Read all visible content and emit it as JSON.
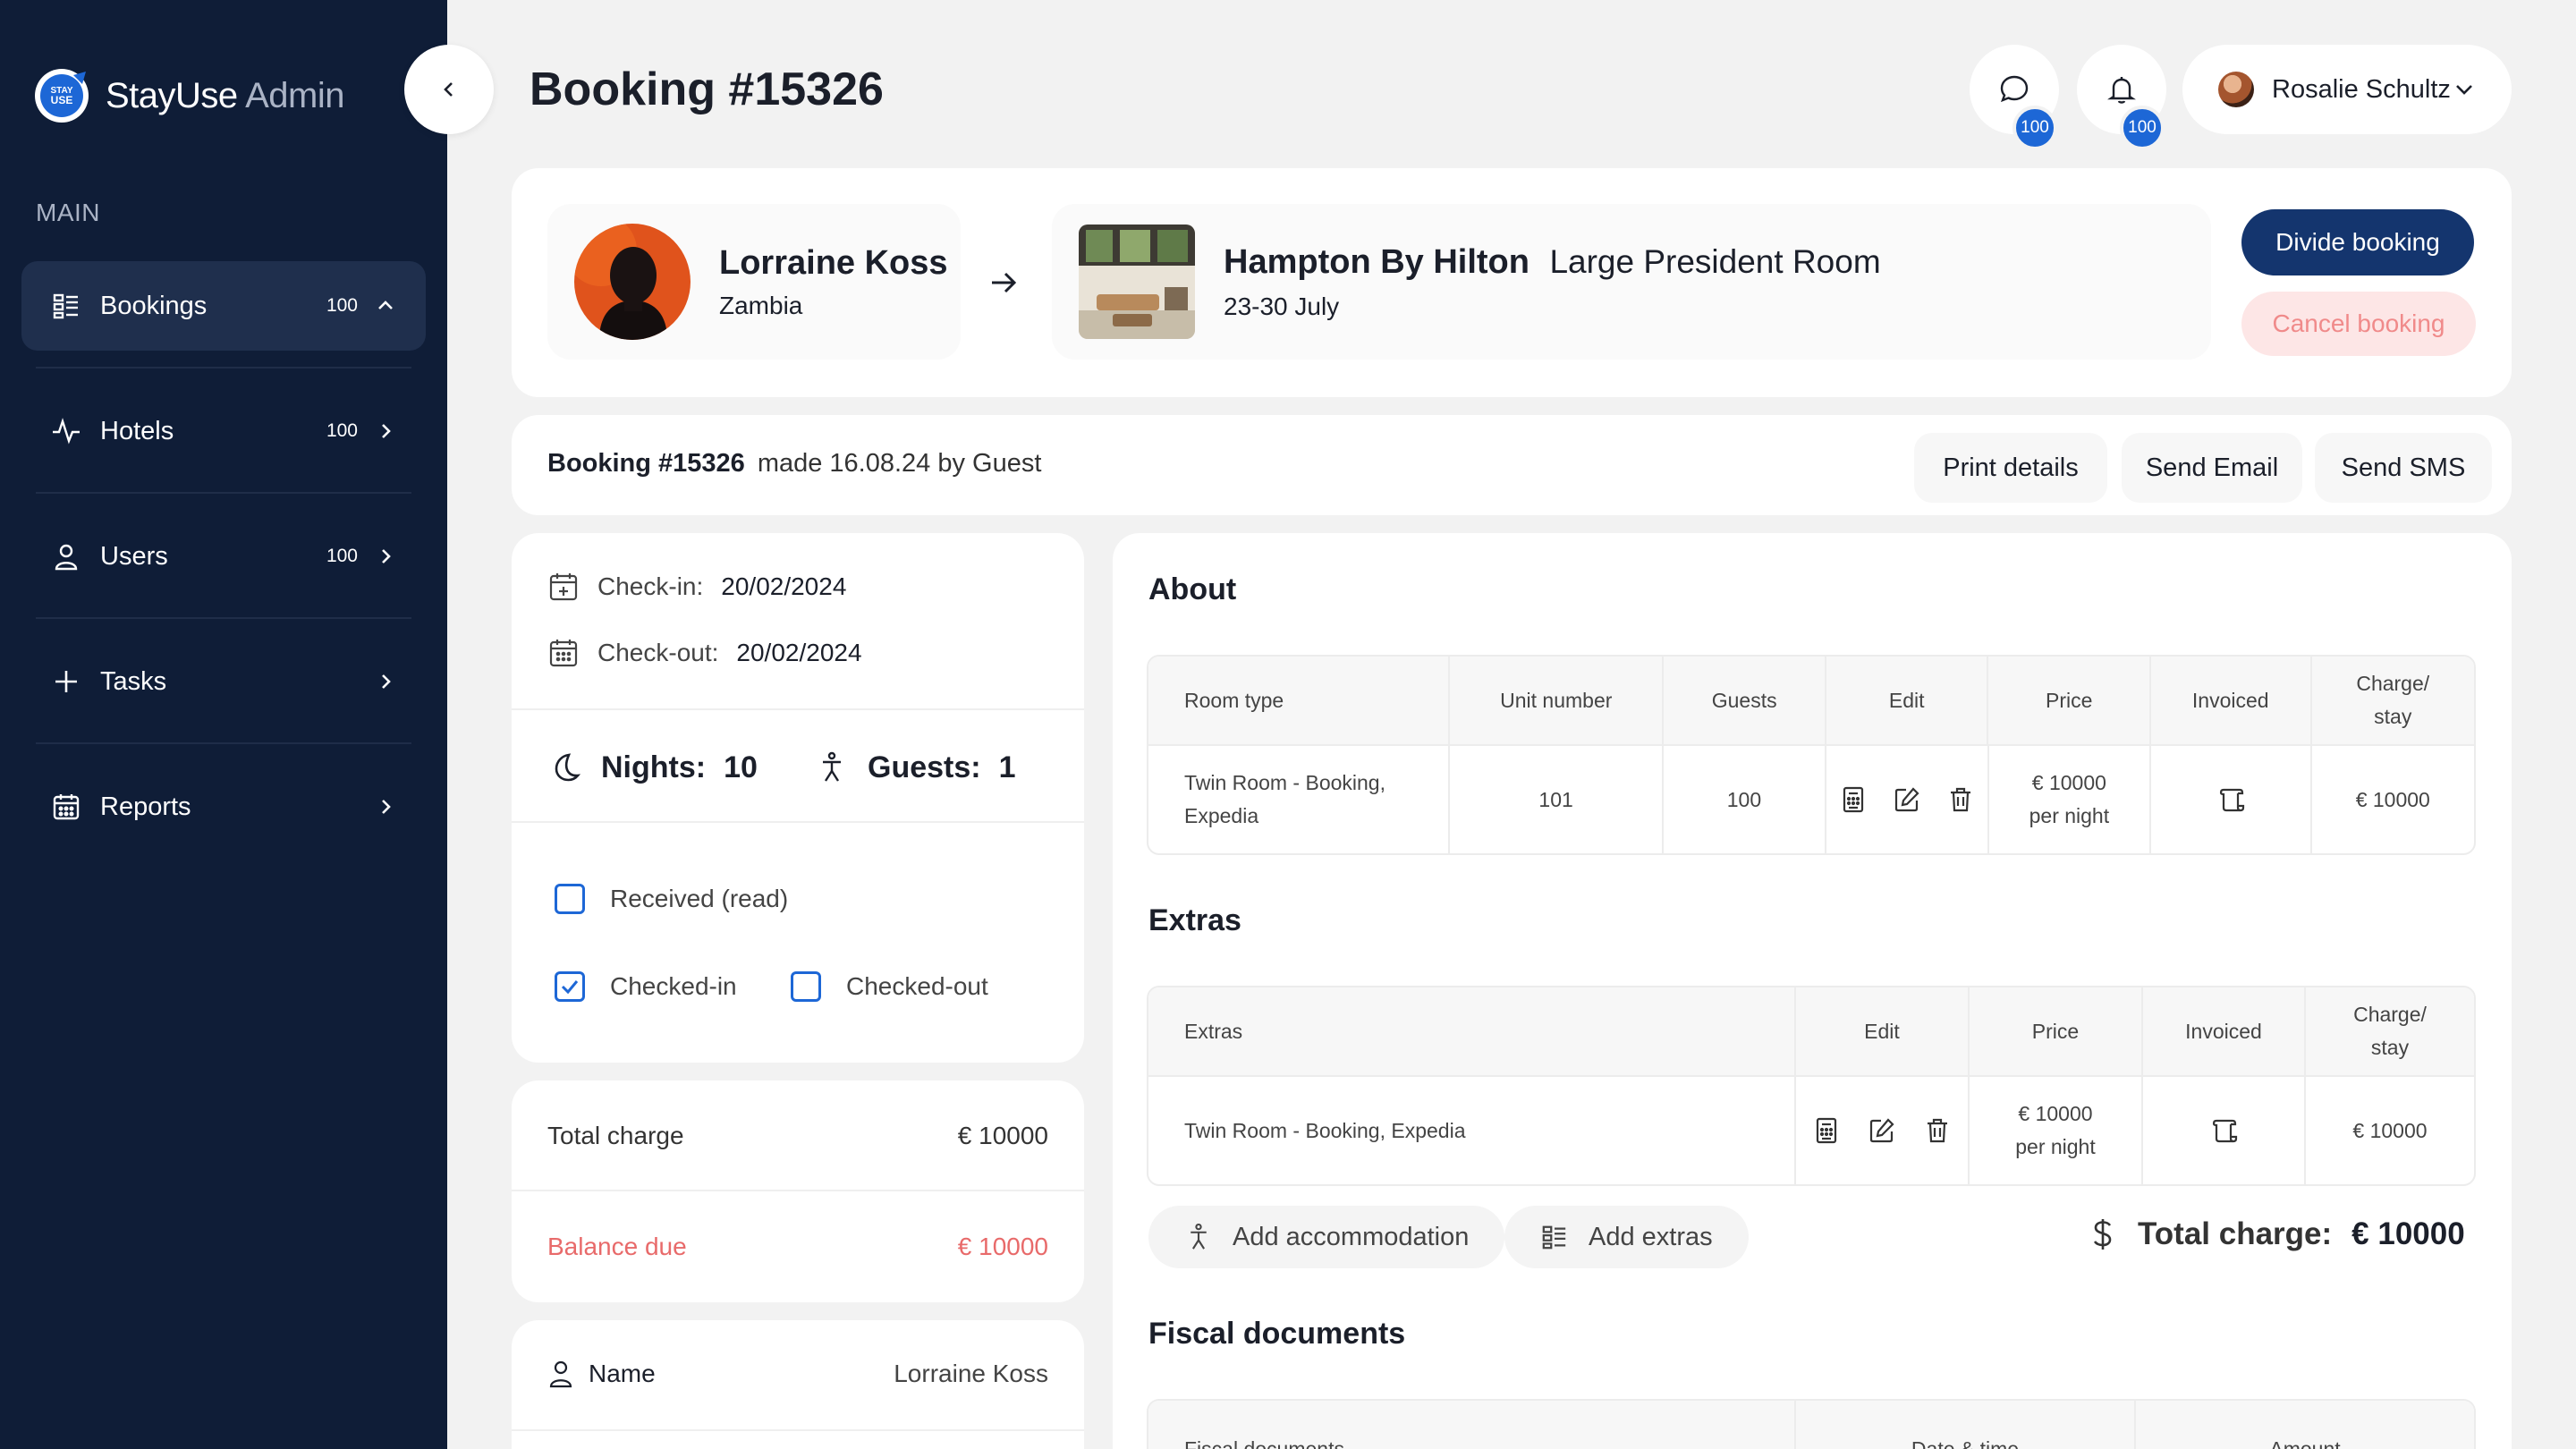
{
  "brand": {
    "logo_text": "STAY USE",
    "name_main": "StayUse",
    "name_sub": "Admin"
  },
  "sidebar": {
    "section_label": "MAIN",
    "items": [
      {
        "label": "Bookings",
        "count": "100",
        "icon": "bookings-icon"
      },
      {
        "label": "Hotels",
        "count": "100",
        "icon": "activity-icon"
      },
      {
        "label": "Users",
        "count": "100",
        "icon": "user-icon"
      },
      {
        "label": "Tasks",
        "count": "",
        "icon": "plus-icon"
      },
      {
        "label": "Reports",
        "count": "",
        "icon": "calendar-icon"
      }
    ]
  },
  "header": {
    "title": "Booking #15326",
    "messages_badge": "100",
    "notifications_badge": "100",
    "user_name": "Rosalie Schultz"
  },
  "guest": {
    "name": "Lorraine Koss",
    "country": "Zambia"
  },
  "hotel": {
    "name": "Hampton By Hilton",
    "room": "Large President Room",
    "dates": "23-30 July"
  },
  "buttons": {
    "divide": "Divide booking",
    "cancel": "Cancel booking"
  },
  "booking_bar": {
    "id": "Booking #15326",
    "made": "made 16.08.24 by Guest",
    "actions": [
      "Print details",
      "Send Email",
      "Send SMS"
    ]
  },
  "dates": {
    "checkin_label": "Check-in:",
    "checkin_value": "20/02/2024",
    "checkout_label": "Check-out:",
    "checkout_value": "20/02/2024"
  },
  "stats": {
    "nights_label": "Nights:",
    "nights_value": "10",
    "guests_label": "Guests:",
    "guests_value": "1"
  },
  "status": {
    "received": {
      "label": "Received (read)",
      "checked": false
    },
    "checked_in": {
      "label": "Checked-in",
      "checked": true
    },
    "checked_out": {
      "label": "Checked-out",
      "checked": false
    }
  },
  "charges": {
    "total_label": "Total charge",
    "total_value": "€ 10000",
    "balance_label": "Balance due",
    "balance_value": "€ 10000"
  },
  "contact": {
    "name_label": "Name",
    "name_value": "Lorraine Koss"
  },
  "about": {
    "title": "About",
    "headers": [
      "Room type",
      "Unit number",
      "Guests",
      "Edit",
      "Price",
      "Invoiced",
      "Charge/\nstay"
    ],
    "rows": [
      {
        "room_type": "Twin Room - Booking, Expedia",
        "unit": "101",
        "guests": "100",
        "price": "€ 10000\nper night",
        "charge": "€ 10000"
      }
    ]
  },
  "extras": {
    "title": "Extras",
    "headers": [
      "Extras",
      "Edit",
      "Price",
      "Invoiced",
      "Charge/\nstay"
    ],
    "rows": [
      {
        "name": "Twin Room - Booking, Expedia",
        "price": "€ 10000\nper night",
        "charge": "€ 10000"
      }
    ],
    "add_accommodation": "Add accommodation",
    "add_extras": "Add extras",
    "total_label": "Total charge:",
    "total_value": "€ 10000"
  },
  "fiscal": {
    "title": "Fiscal documents",
    "headers": [
      "Fiscal documents",
      "Date & time",
      "Amount"
    ]
  },
  "colors": {
    "sidebar_bg": "#0f1d37",
    "primary": "#14356e",
    "accent": "#1d67d6",
    "danger": "#f08a8a",
    "page_bg": "#f2f2f2"
  }
}
